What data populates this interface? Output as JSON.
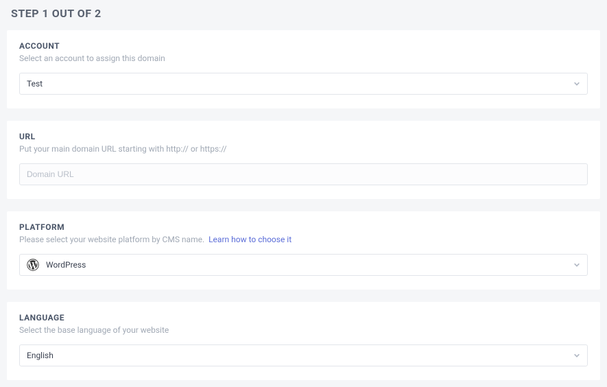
{
  "page_title": "STEP 1 OUT OF 2",
  "account": {
    "label": "ACCOUNT",
    "desc": "Select an account to assign this domain",
    "value": "Test"
  },
  "url": {
    "label": "URL",
    "desc": "Put your main domain URL starting with http:// or https://",
    "placeholder": "Domain URL"
  },
  "platform": {
    "label": "PLATFORM",
    "desc_prefix": "Please select your website platform by CMS name.",
    "link_text": "Learn how to choose it",
    "value": "WordPress"
  },
  "language": {
    "label": "LANGUAGE",
    "desc": "Select the base language of your website",
    "value": "English"
  }
}
